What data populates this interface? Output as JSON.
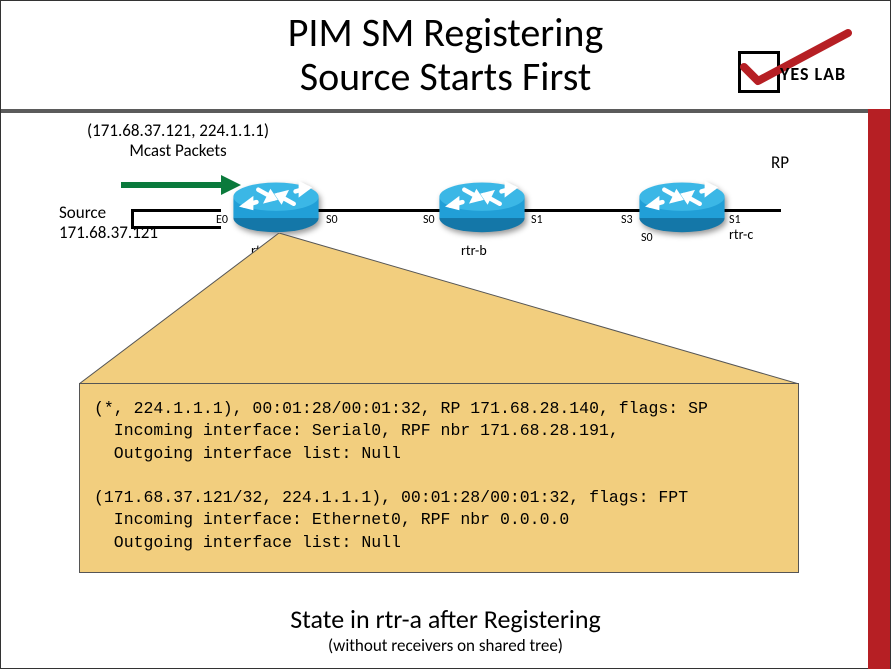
{
  "header": {
    "title_line1": "PIM SM Registering",
    "title_line2": "Source Starts First",
    "brand": "YES LAB"
  },
  "diagram": {
    "packet_label": "(171.68.37.121, 224.1.1.1)\nMcast Packets",
    "source_label": "Source\n171.68.37.121",
    "rp_label": "RP",
    "rtr_a": "rtr-a",
    "rtr_b": "rtr-b",
    "rtr_c": "rtr-c",
    "if_e0": "E0",
    "if_s0a": "S0",
    "if_s0b": "S0",
    "if_s1b": "S1",
    "if_s3c": "S3",
    "if_s0c": "S0",
    "if_s1c": "S1"
  },
  "cli": {
    "line1": "(*, 224.1.1.1), 00:01:28/00:01:32, RP 171.68.28.140, flags: SP",
    "line2": "  Incoming interface: Serial0, RPF nbr 171.68.28.191,",
    "line3": "  Outgoing interface list: Null",
    "line4": "",
    "line5": "(171.68.37.121/32, 224.1.1.1), 00:01:28/00:01:32, flags: FPT",
    "line6": "  Incoming interface: Ethernet0, RPF nbr 0.0.0.0",
    "line7": "  Outgoing interface list: Null"
  },
  "caption": {
    "main": "State in rtr-a after Registering",
    "sub": "(without receivers on shared tree)"
  },
  "colors": {
    "accent_red": "#b61f24",
    "router_blue": "#219fd7",
    "callout_fill": "#f2ce7e"
  }
}
